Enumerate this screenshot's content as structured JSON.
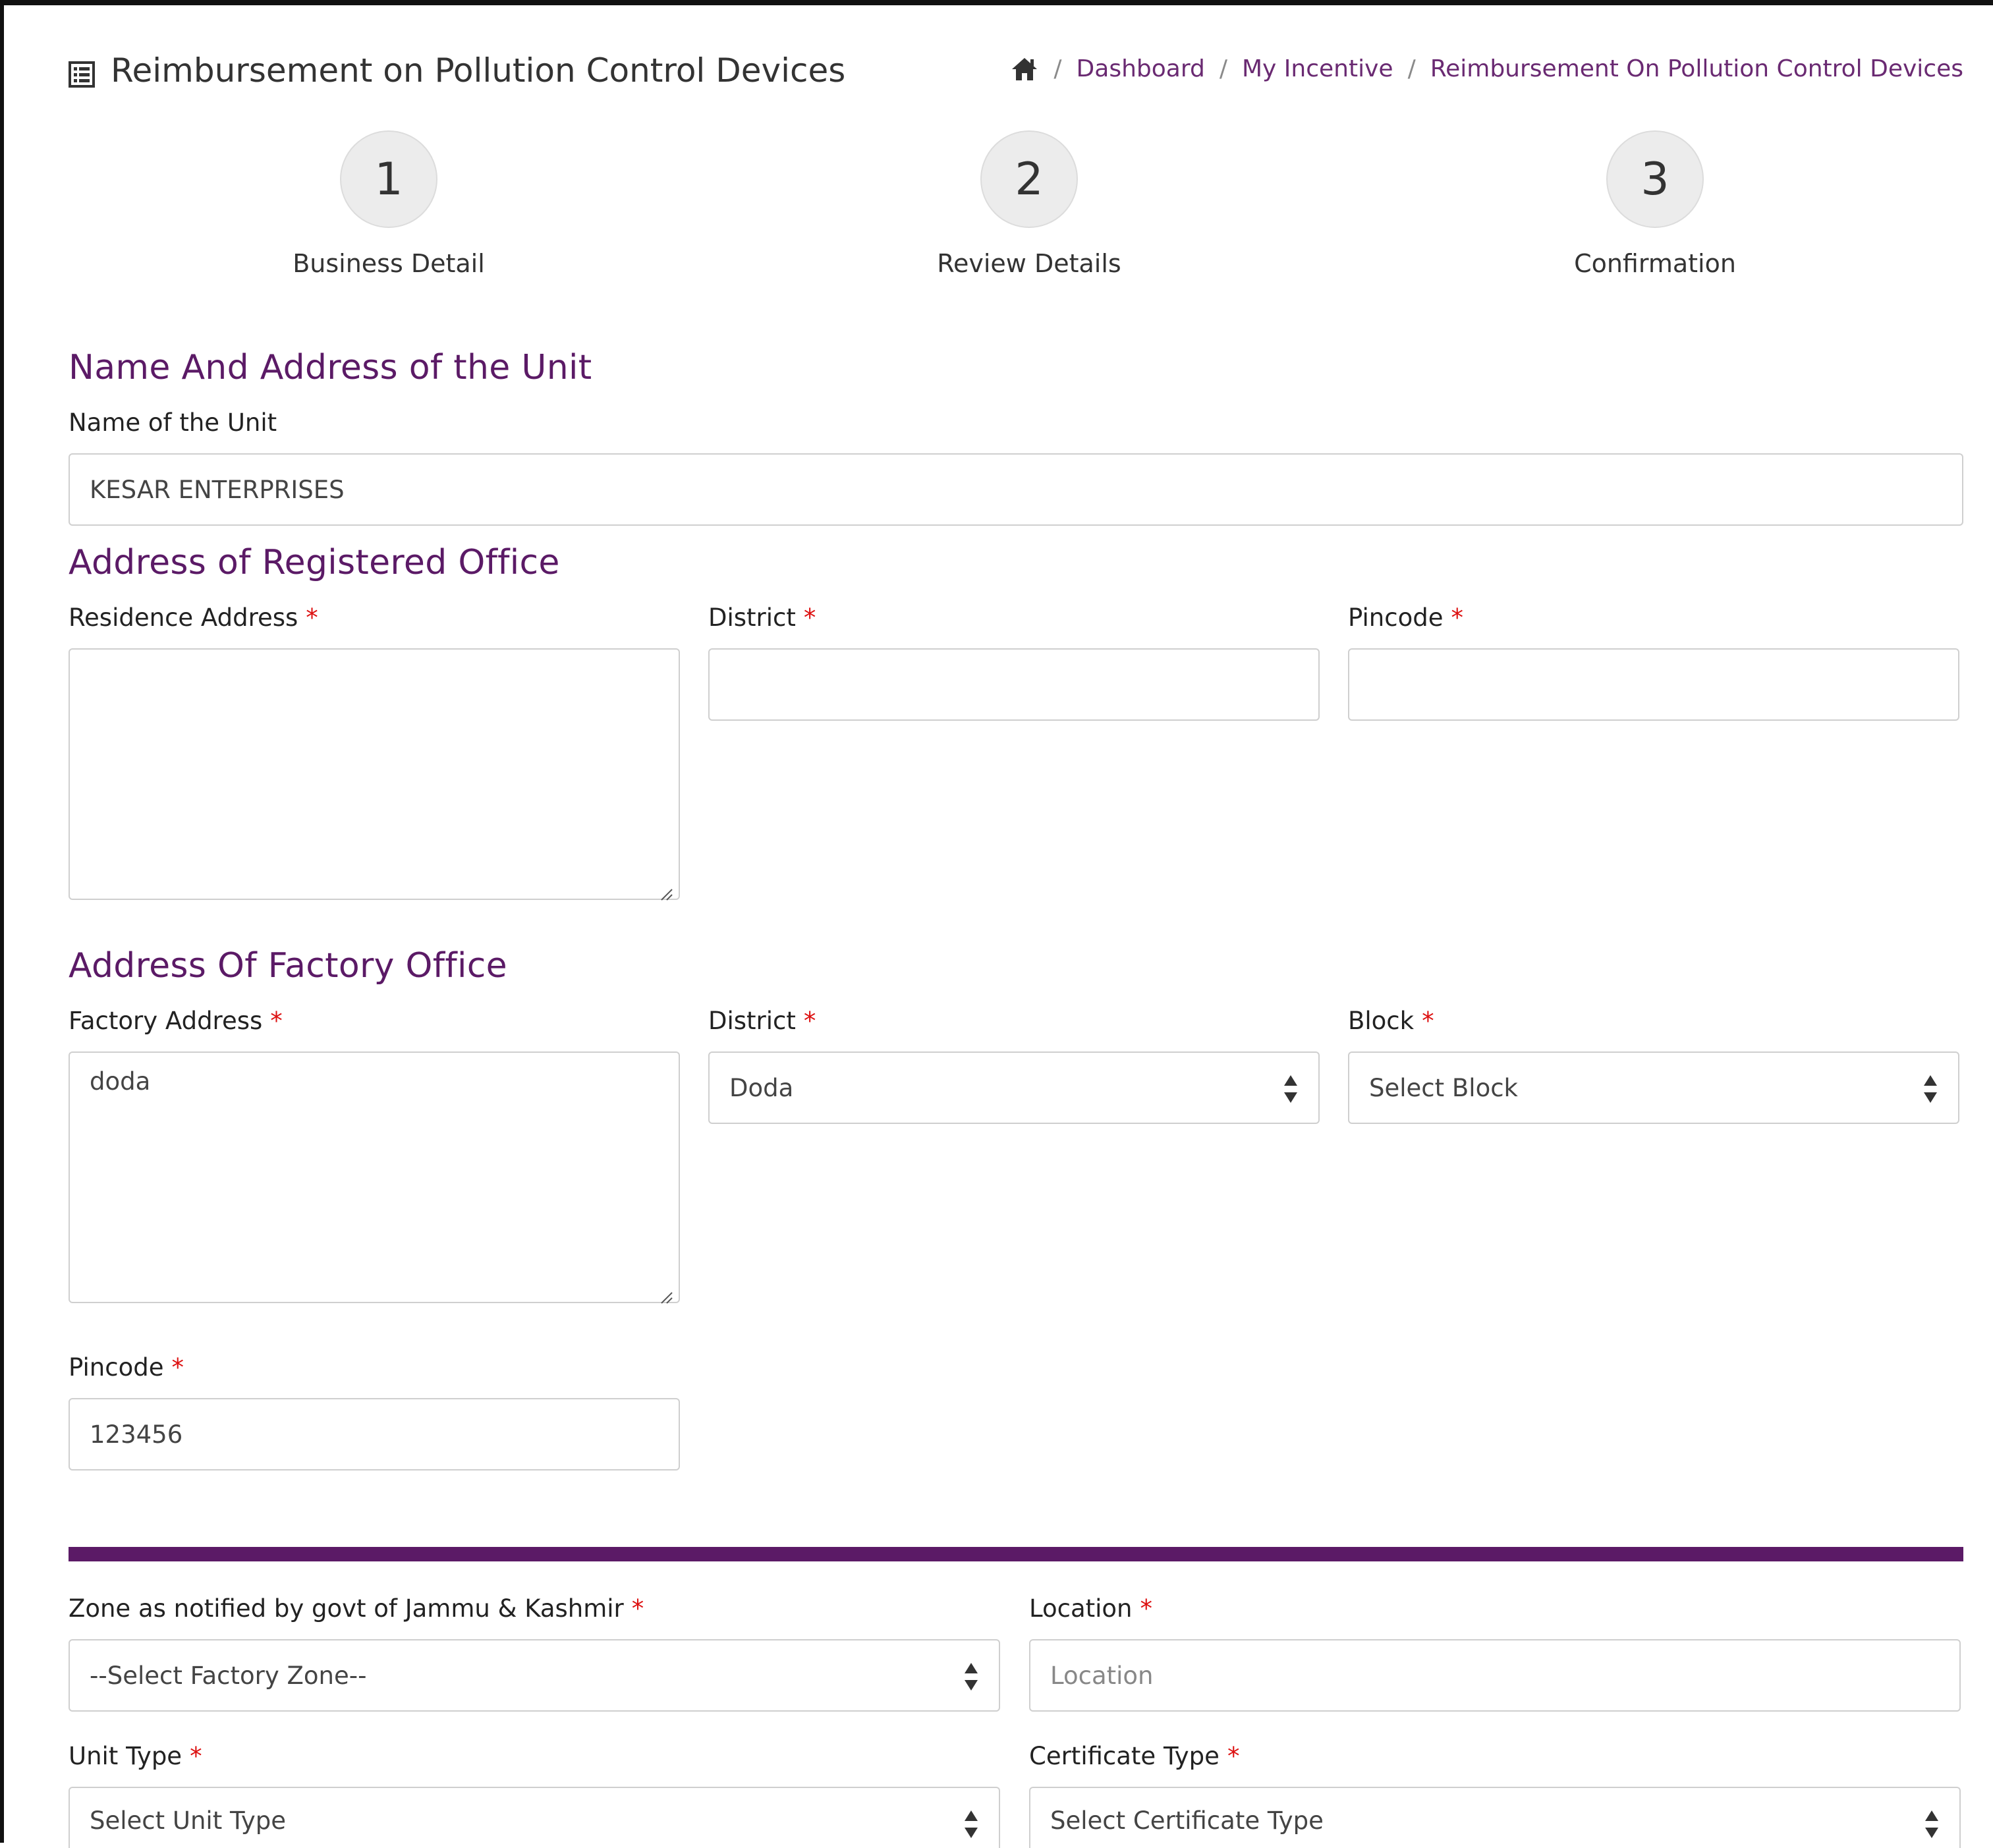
{
  "header": {
    "title": "Reimbursement on Pollution Control Devices",
    "title_icon": "list-alt-icon",
    "breadcrumb": {
      "home_icon": "home-icon",
      "sep": "/",
      "items": [
        "Dashboard",
        "My Incentive",
        "Reimbursement On Pollution Control Devices"
      ]
    }
  },
  "stepper": {
    "steps": [
      {
        "number": "1",
        "label": "Business Detail"
      },
      {
        "number": "2",
        "label": "Review Details"
      },
      {
        "number": "3",
        "label": "Confirmation"
      }
    ]
  },
  "unit": {
    "section_title": "Name And Address of the Unit",
    "name_label": "Name of the Unit",
    "name_value": "KESAR ENTERPRISES"
  },
  "registered": {
    "section_title": "Address of Registered Office",
    "address_label": "Residence Address",
    "address_value": "",
    "district_label": "District",
    "district_value": "",
    "pincode_label": "Pincode",
    "pincode_value": ""
  },
  "factory": {
    "section_title": "Address Of Factory Office",
    "address_label": "Factory Address",
    "address_value": "doda",
    "district_label": "District",
    "district_value": "Doda",
    "block_label": "Block",
    "block_value": "Select Block",
    "pincode_label": "Pincode",
    "pincode_value": "123456"
  },
  "details": {
    "zone_label": "Zone as notified by govt of Jammu & Kashmir",
    "zone_value": "--Select Factory Zone--",
    "location_label": "Location",
    "location_placeholder": "Location",
    "unit_type_label": "Unit Type",
    "unit_type_value": "Select Unit Type",
    "certificate_label": "Certificate Type",
    "certificate_value": "Select Certificate Type"
  },
  "required_mark": "*",
  "colors": {
    "accent": "#5b1a66",
    "link": "#6a2a72",
    "required": "#dd1111"
  }
}
